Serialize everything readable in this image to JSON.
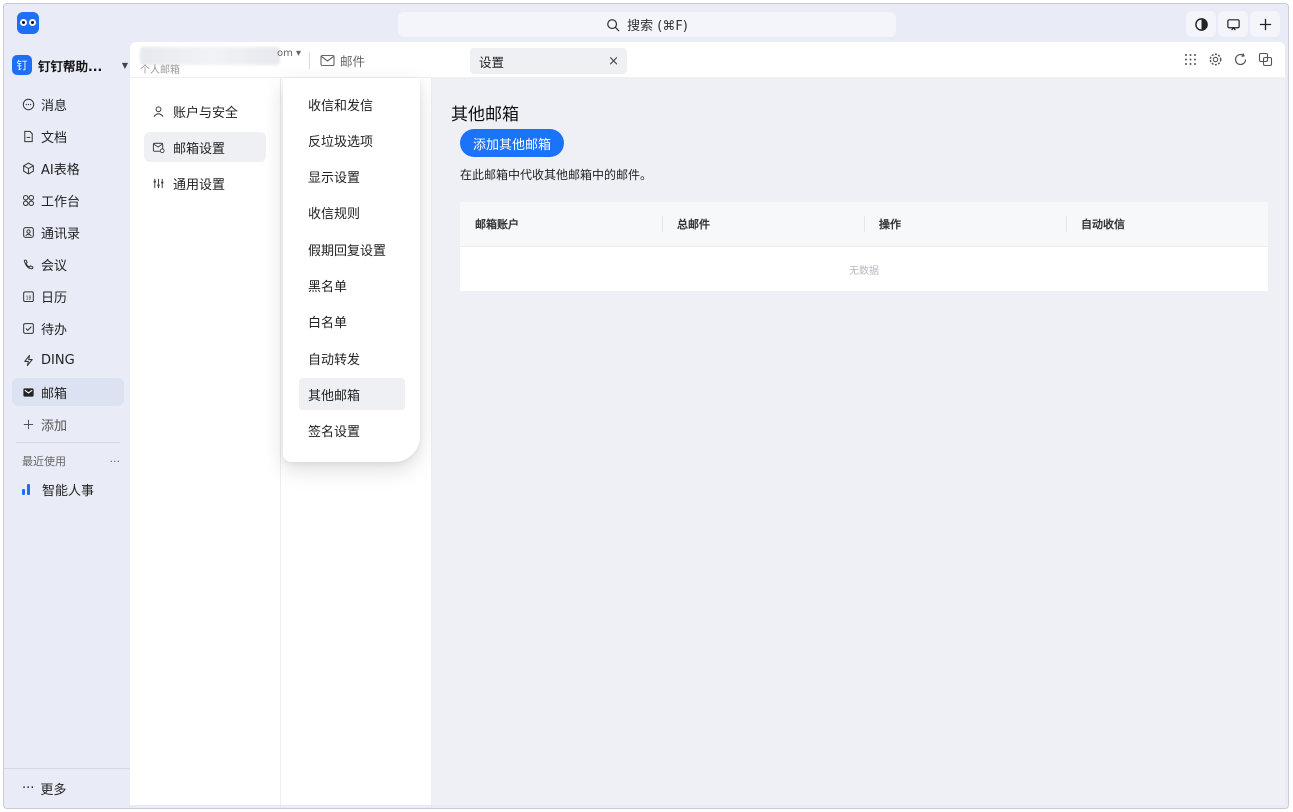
{
  "titlebar": {
    "search_label": "搜索 (⌘F)"
  },
  "sidebar": {
    "org_badge": "钉",
    "org_name": "钉钉帮助...",
    "items": [
      {
        "label": "消息",
        "icon": "chat-bubble-icon"
      },
      {
        "label": "文档",
        "icon": "document-icon"
      },
      {
        "label": "AI表格",
        "icon": "ai-table-icon"
      },
      {
        "label": "工作台",
        "icon": "workbench-grid-icon"
      },
      {
        "label": "通讯录",
        "icon": "contacts-icon"
      },
      {
        "label": "会议",
        "icon": "meeting-phone-icon"
      },
      {
        "label": "日历",
        "icon": "calendar-icon"
      },
      {
        "label": "待办",
        "icon": "todo-check-icon"
      },
      {
        "label": "DING",
        "icon": "ding-lightning-icon"
      },
      {
        "label": "邮箱",
        "icon": "mail-icon",
        "active": true
      },
      {
        "label": "添加",
        "icon": "plus-icon"
      }
    ],
    "recent_label": "最近使用",
    "recent_more": "···",
    "recent_items": [
      {
        "label": "智能人事"
      }
    ],
    "more_label": "更多",
    "more_icon": "···"
  },
  "tabbar": {
    "account_tail": "om ▾",
    "account_sub": "个人邮箱",
    "mail_tab": "邮件",
    "settings_tab": "设置",
    "settings_close": "×"
  },
  "settings_nav": [
    {
      "label": "账户与安全",
      "icon": "user-icon"
    },
    {
      "label": "邮箱设置",
      "icon": "mailbox-settings-icon",
      "active": true
    },
    {
      "label": "通用设置",
      "icon": "sliders-icon"
    }
  ],
  "mail_settings_menu": [
    {
      "label": "收信和发信"
    },
    {
      "label": "反垃圾选项"
    },
    {
      "label": "显示设置"
    },
    {
      "label": "收信规则"
    },
    {
      "label": "假期回复设置"
    },
    {
      "label": "黑名单"
    },
    {
      "label": "白名单"
    },
    {
      "label": "自动转发"
    },
    {
      "label": "其他邮箱",
      "active": true
    },
    {
      "label": "签名设置"
    }
  ],
  "main": {
    "title": "其他邮箱",
    "add_button": "添加其他邮箱",
    "description": "在此邮箱中代收其他邮箱中的邮件。",
    "table": {
      "headers": [
        "邮箱账户",
        "总邮件",
        "操作",
        "自动收信"
      ],
      "empty_text": "无数据"
    }
  },
  "colors": {
    "accent": "#1a73f8",
    "sidebar_bg": "#e9ecf6",
    "main_bg": "#eff0f6"
  }
}
